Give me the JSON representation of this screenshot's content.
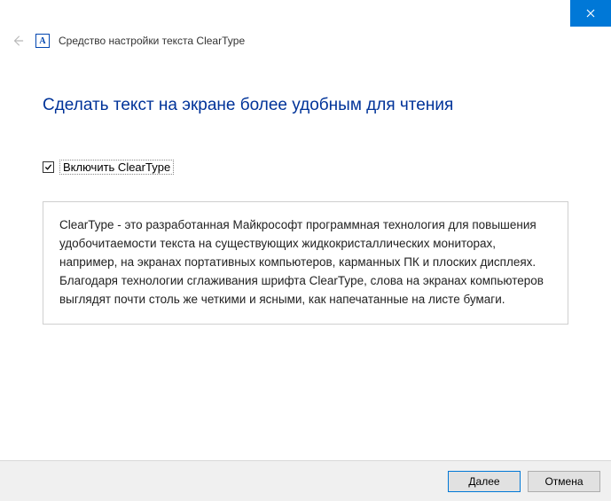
{
  "titlebar": {
    "close_icon": "close"
  },
  "header": {
    "back_icon": "back-arrow",
    "app_icon_letter": "A",
    "title": "Средство настройки текста ClearType"
  },
  "main": {
    "heading": "Сделать текст на экране более удобным для чтения",
    "checkbox": {
      "checked": true,
      "label": "Включить ClearType"
    },
    "description": "ClearType - это разработанная Майкрософт программная технология для повышения удобочитаемости текста на существующих жидкокристаллических мониторах, например, на экранах портативных компьютеров, карманных ПК и плоских дисплеях. Благодаря технологии сглаживания шрифта ClearType, слова на экранах компьютеров выглядят почти столь же четкими и ясными, как напечатанные на листе бумаги."
  },
  "footer": {
    "next_label": "Далее",
    "cancel_label": "Отмена"
  }
}
